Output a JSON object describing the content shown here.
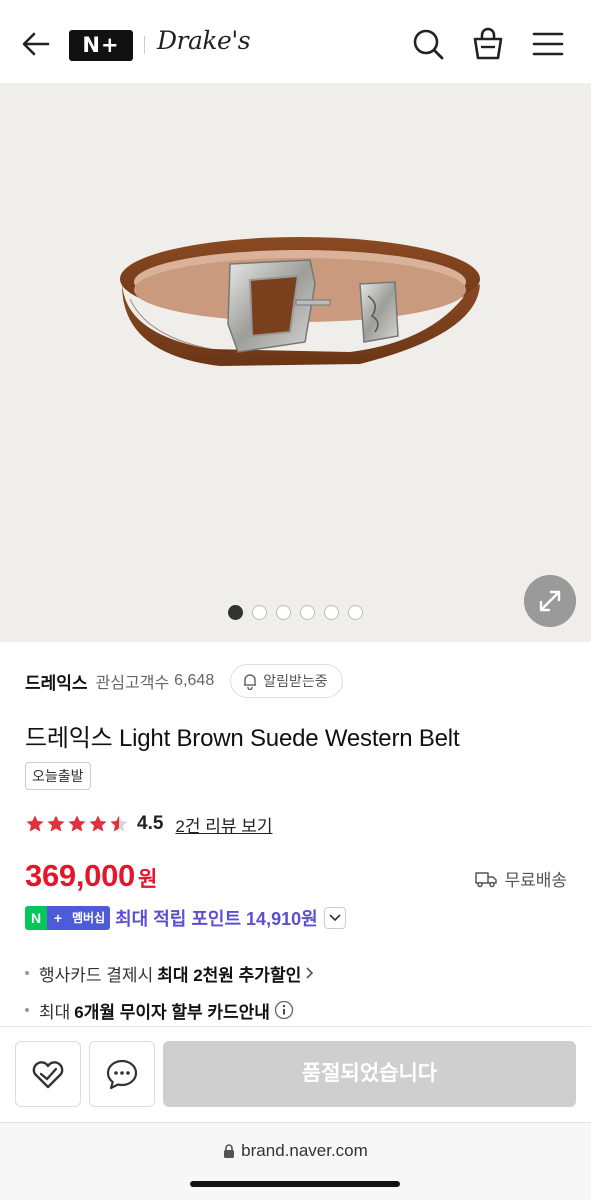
{
  "header": {
    "store_badge": "N+",
    "brand_logo": "Drake's",
    "icons": [
      "back-arrow-icon",
      "search-icon",
      "shopping-bag-icon",
      "hamburger-menu-icon"
    ]
  },
  "gallery": {
    "total_images": 6,
    "active_index": 0
  },
  "brand": {
    "name": "드레익스",
    "follower_label": "관심고객수",
    "follower_count": "6,648",
    "notify_label": "알림받는중"
  },
  "product": {
    "title": "드레익스 Light Brown Suede Western Belt",
    "tag": "오늘출발",
    "rating_score": "4.5",
    "rating_value": 4.5,
    "review_link": "2건 리뷰 보기",
    "price": "369,000",
    "currency": "원",
    "shipping": "무료배송"
  },
  "membership": {
    "badge_n": "N",
    "badge_plus": "+",
    "badge_text": "멤버십",
    "text": "최대 적립 포인트 14,910원"
  },
  "benefits": {
    "card_prefix": "행사카드 결제시",
    "card_bold": "최대 2천원 추가할인",
    "installment_prefix": "최대",
    "installment_bold": "6개월 무이자 할부 카드안내"
  },
  "bottom_bar": {
    "soldout_label": "품절되었습니다"
  },
  "browser": {
    "url": "brand.naver.com"
  },
  "colors": {
    "price_red": "#e4162b",
    "naver_green": "#03c75a",
    "membership_purple": "#5b4ed0",
    "star_red": "#e0323c"
  }
}
